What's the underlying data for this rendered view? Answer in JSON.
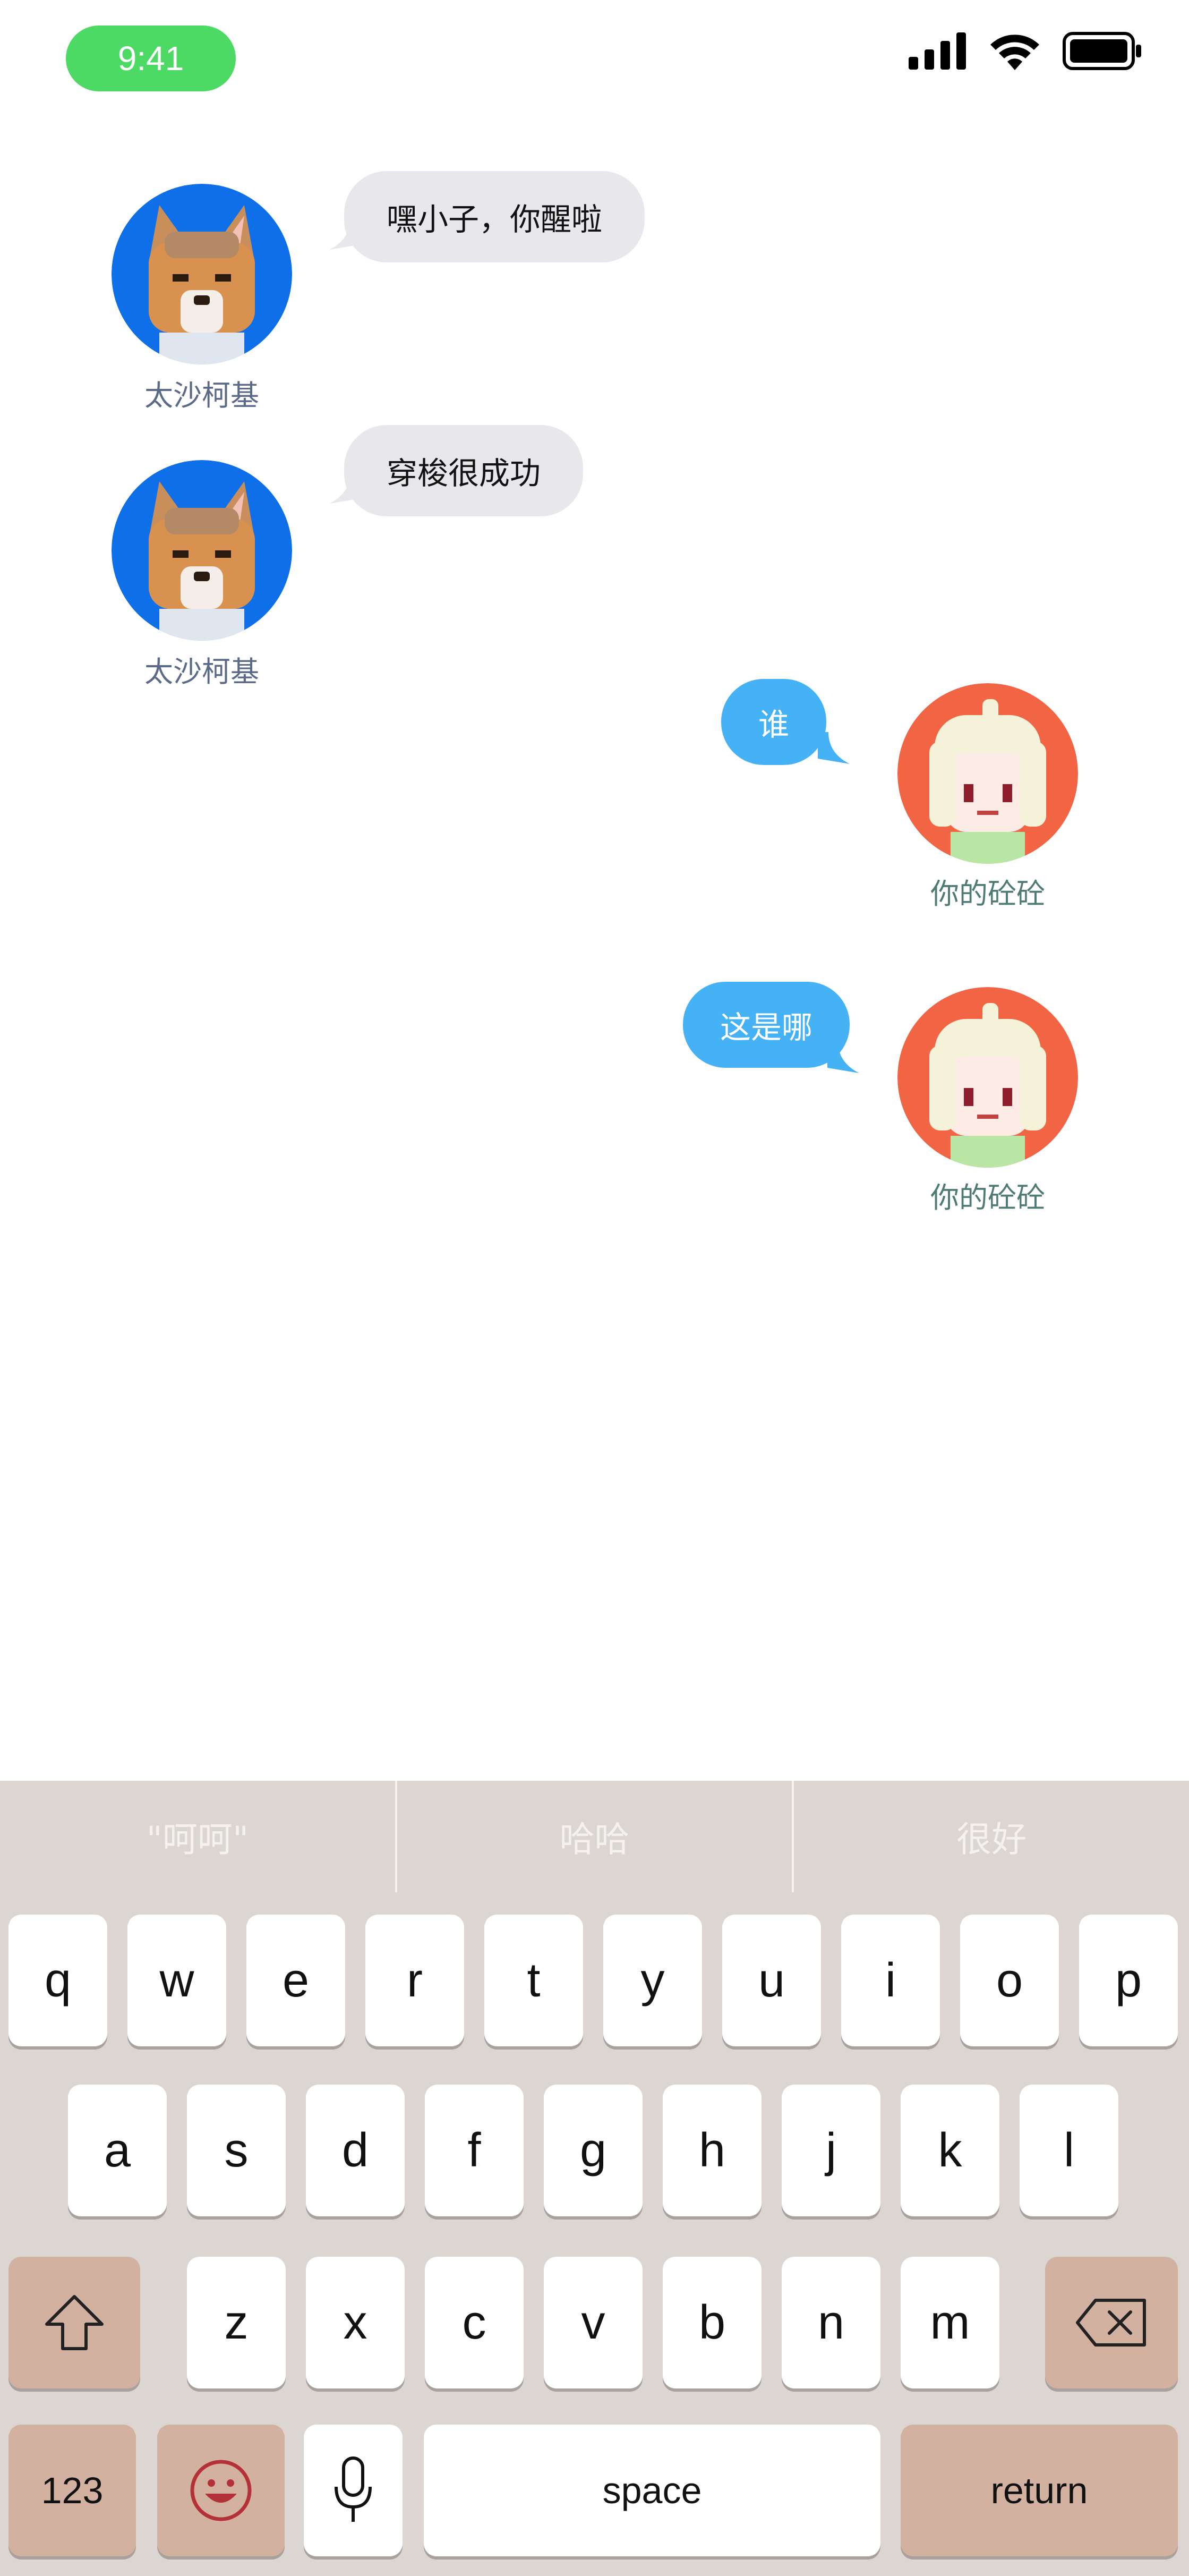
{
  "status_bar": {
    "time": "9:41",
    "signal_icon": "signal-bars-icon",
    "wifi_icon": "wifi-icon",
    "battery_icon": "battery-icon"
  },
  "messages": [
    {
      "side": "left",
      "sender": "太沙柯基",
      "text": "嘿小子，你醒啦",
      "avatar": "corgi-avatar-icon"
    },
    {
      "side": "left",
      "sender": "太沙柯基",
      "text": "穿梭很成功",
      "avatar": "corgi-avatar-icon"
    },
    {
      "side": "right",
      "sender": "你的砼砼",
      "text": "谁",
      "avatar": "girl-avatar-icon"
    },
    {
      "side": "right",
      "sender": "你的砼砼",
      "text": "这是哪",
      "avatar": "girl-avatar-icon"
    }
  ],
  "keyboard": {
    "suggestions": [
      "\"呵呵\"",
      "哈哈",
      "很好"
    ],
    "row1": [
      "q",
      "w",
      "e",
      "r",
      "t",
      "y",
      "u",
      "i",
      "o",
      "p"
    ],
    "row2": [
      "a",
      "s",
      "d",
      "f",
      "g",
      "h",
      "j",
      "k",
      "l"
    ],
    "row3": [
      "z",
      "x",
      "c",
      "v",
      "b",
      "n",
      "m"
    ],
    "num_label": "123",
    "space_label": "space",
    "return_label": "return",
    "shift_icon": "shift-icon",
    "delete_icon": "delete-icon",
    "emoji_icon": "emoji-icon",
    "mic_icon": "microphone-icon"
  },
  "colors": {
    "left_bubble": "#e8e8ec",
    "right_bubble": "#45b2f5",
    "time_pill": "#4cd964",
    "keyboard_bg": "#dcd6d2",
    "func_key": "#d2b1a1"
  }
}
